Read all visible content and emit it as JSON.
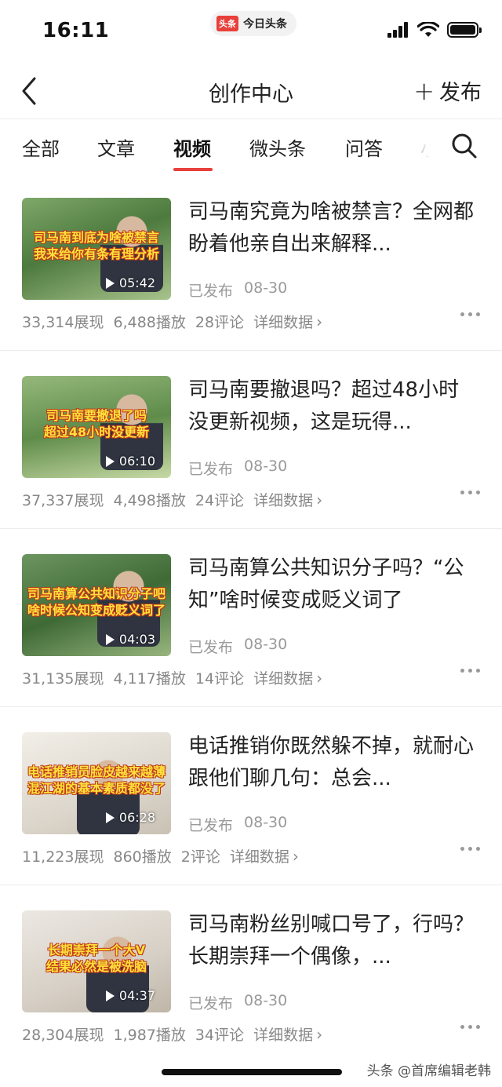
{
  "status_bar": {
    "time": "16:11",
    "app_logo": "头条",
    "app_name": "今日头条"
  },
  "nav": {
    "title": "创作中心",
    "publish_label": "发布",
    "back_icon": "chevron-left-icon"
  },
  "tabs": [
    {
      "label": "全部"
    },
    {
      "label": "文章"
    },
    {
      "label": "视频"
    },
    {
      "label": "微头条"
    },
    {
      "label": "问答"
    },
    {
      "label": "小"
    }
  ],
  "active_tab": "视频",
  "colors": {
    "accent": "#e8403a",
    "caption": "#ffe23a"
  },
  "items": [
    {
      "caption_line1": "司马南到底为啥被禁言",
      "caption_line2": "我来给你有条有理分析",
      "duration": "05:42",
      "title": "司马南究竟为啥被禁言？全网都盼着他亲自出来解释...",
      "status": "已发布",
      "date": "08-30",
      "impressions": "33,314展现",
      "plays": "6,488播放",
      "comments": "28评论",
      "detail": "详细数据"
    },
    {
      "caption_line1": "司马南要撤退了吗",
      "caption_line2": "超过48小时没更新",
      "duration": "06:10",
      "title": "司马南要撤退吗？超过48小时没更新视频，这是玩得...",
      "status": "已发布",
      "date": "08-30",
      "impressions": "37,337展现",
      "plays": "4,498播放",
      "comments": "24评论",
      "detail": "详细数据"
    },
    {
      "caption_line1": "司马南算公共知识分子吧",
      "caption_line2": "啥时候公知变成贬义词了",
      "duration": "04:03",
      "title": "司马南算公共知识分子吗？“公知”啥时候变成贬义词了",
      "status": "已发布",
      "date": "08-30",
      "impressions": "31,135展现",
      "plays": "4,117播放",
      "comments": "14评论",
      "detail": "详细数据"
    },
    {
      "caption_line1": "电话推销员脸皮越来越薄",
      "caption_line2": "混江湖的基本素质都没了",
      "duration": "06:28",
      "title": "电话推销你既然躲不掉，就耐心跟他们聊几句：总会...",
      "status": "已发布",
      "date": "08-30",
      "impressions": "11,223展现",
      "plays": "860播放",
      "comments": "2评论",
      "detail": "详细数据"
    },
    {
      "caption_line1": "长期崇拜一个大V",
      "caption_line2": "结果必然是被洗脑",
      "duration": "04:37",
      "title": "司马南粉丝别喊口号了，行吗？长期崇拜一个偶像，...",
      "status": "已发布",
      "date": "08-30",
      "impressions": "28,304展现",
      "plays": "1,987播放",
      "comments": "34评论",
      "detail": "详细数据"
    }
  ],
  "watermark": "头条 @首席编辑老韩"
}
